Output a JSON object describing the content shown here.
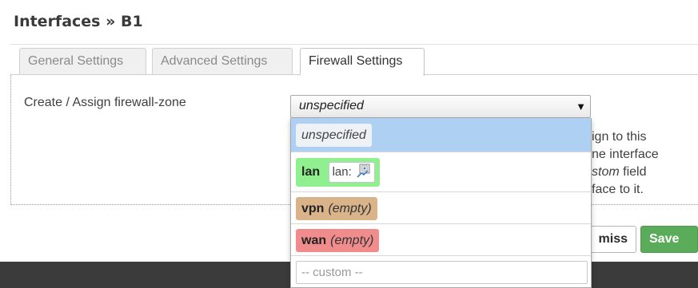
{
  "modal": {
    "title": "Interfaces » B1",
    "tabs": [
      {
        "label": "General Settings",
        "active": false
      },
      {
        "label": "Advanced Settings",
        "active": false
      },
      {
        "label": "Firewall Settings",
        "active": true
      }
    ]
  },
  "form": {
    "field_label": "Create / Assign firewall-zone",
    "select_value": "unspecified",
    "description_lines": [
      "ign to this",
      "ne interface",
      "stom field",
      "face to it."
    ],
    "description_italic_word": "stom"
  },
  "dropdown": {
    "options": [
      {
        "name": "unspecified",
        "color": "#eef1f6",
        "highlighted": true
      },
      {
        "name": "lan",
        "network_chip": "lan:",
        "device_icon": "network-device-icon",
        "color": "#90f090"
      },
      {
        "name": "vpn",
        "empty": "(empty)",
        "color": "#d9b48a"
      },
      {
        "name": "wan",
        "empty": "(empty)",
        "color": "#f08c8c"
      }
    ],
    "custom_placeholder": "-- custom --"
  },
  "footer": {
    "dismiss_label": "miss",
    "save_label": "Save"
  },
  "colors": {
    "highlight": "#aed0f2",
    "save_button": "#5aac5a",
    "footer_bar": "#3b3b3b"
  }
}
